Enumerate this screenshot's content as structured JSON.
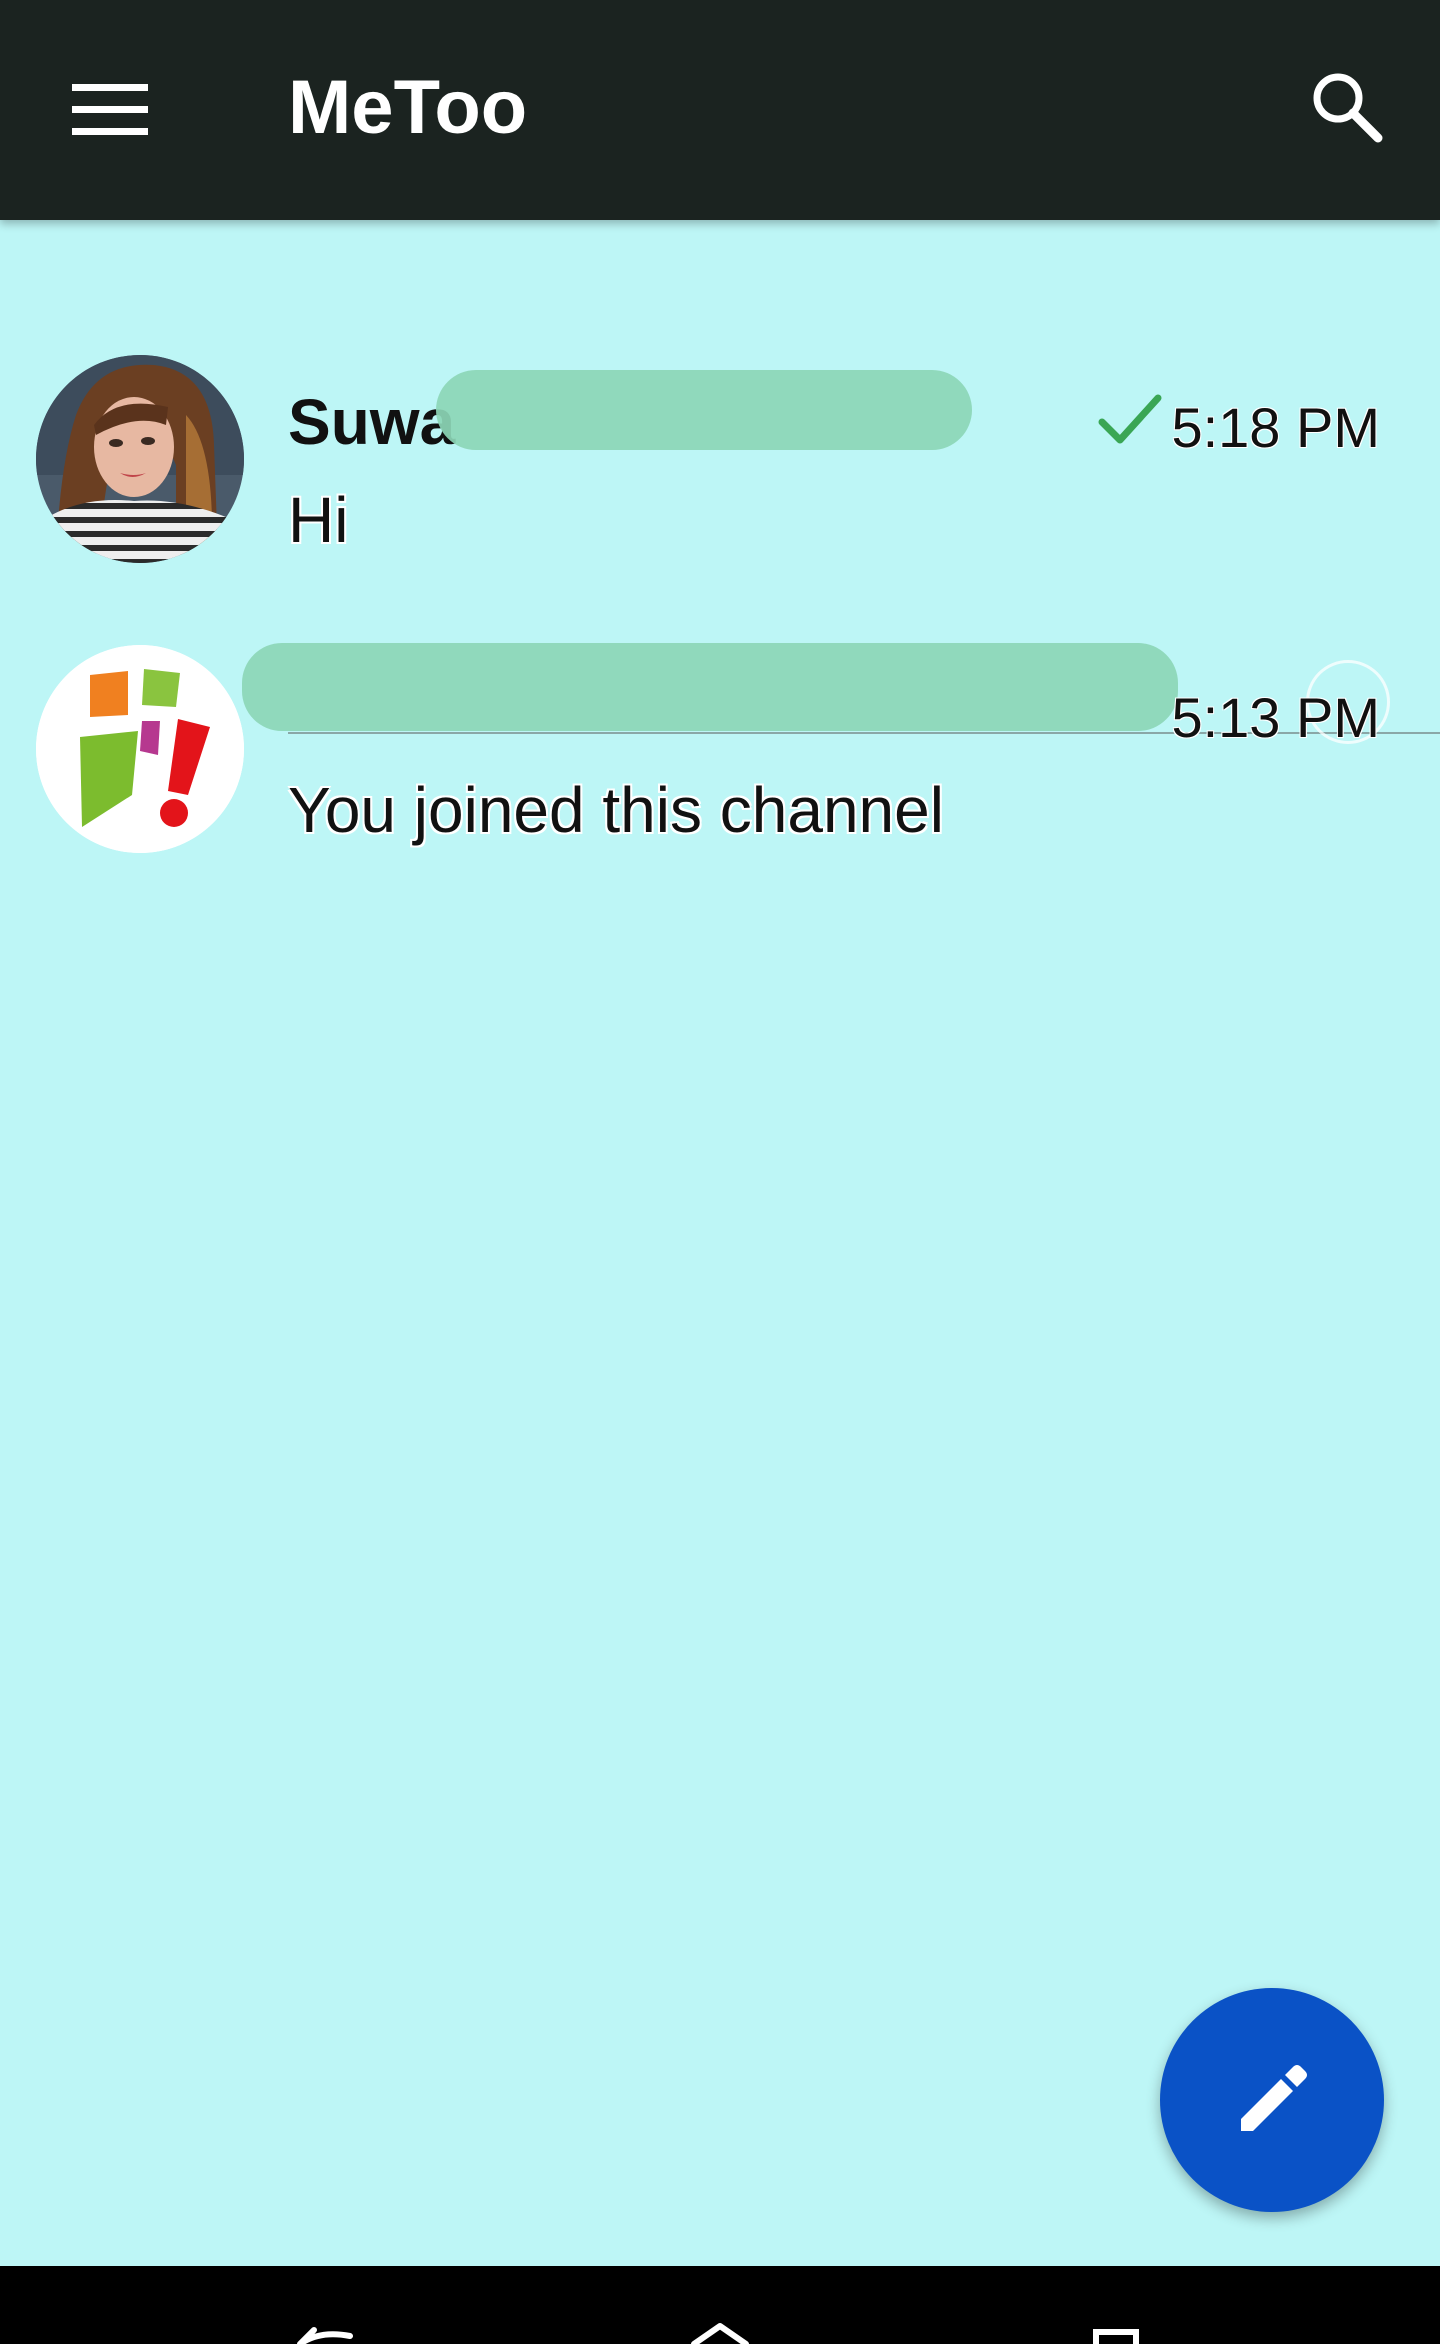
{
  "app_bar": {
    "title": "MeToo",
    "menu_icon": "hamburger-menu-icon",
    "search_icon": "search-icon",
    "background": "#1b2320"
  },
  "chats": [
    {
      "name": "Suwa",
      "time": "5:18 PM",
      "preview": "Hi",
      "status_icon": "checkmark-icon",
      "status_color": "#3aa655",
      "avatar": "user-photo-avatar"
    },
    {
      "name": "",
      "time": "5:13 PM",
      "preview": "You joined this channel",
      "avatar": "appgeyser-channel-logo"
    }
  ],
  "fab": {
    "icon": "pencil-icon",
    "color": "#0a52c6"
  },
  "colors": {
    "list_background": "#bdf6f6",
    "redaction": "#8cd6b6"
  },
  "system_nav": {
    "back_icon": "back-icon",
    "home_icon": "home-icon",
    "recents_icon": "recents-icon"
  }
}
